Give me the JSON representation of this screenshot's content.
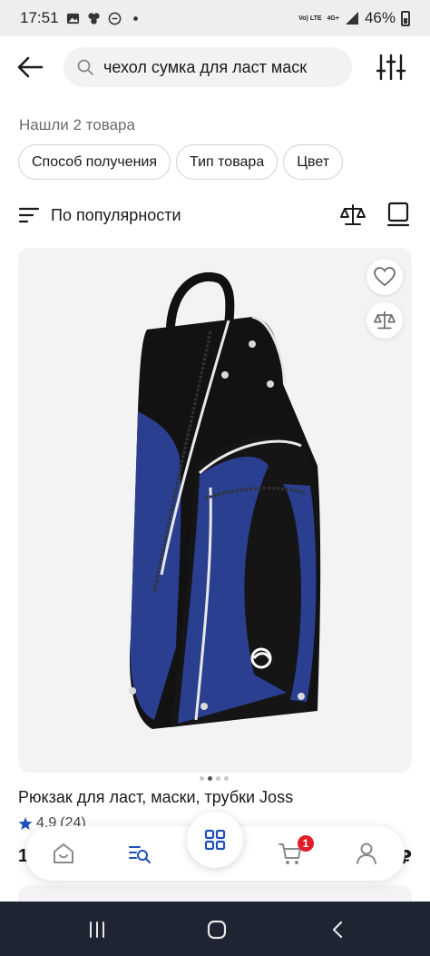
{
  "status_bar": {
    "time": "17:51",
    "signal_text": "4G+",
    "lte_text": "Vo) LTE",
    "battery": "46%"
  },
  "search": {
    "query": "чехол сумка для ласт маск"
  },
  "results": {
    "found_text": "Нашли 2 товара"
  },
  "filters": [
    {
      "label": "Способ получения"
    },
    {
      "label": "Тип товара"
    },
    {
      "label": "Цвет"
    }
  ],
  "sort": {
    "label": "По популярности"
  },
  "product": {
    "title": "Рюкзак для ласт, маски, трубки Joss",
    "rating": "4,9",
    "reviews": "(24)",
    "price_peek_left": "1",
    "price_peek_right": "₽",
    "image_count": 4,
    "active_image": 2,
    "brand_mark": "JOSS"
  },
  "bottom_nav": {
    "items": [
      {
        "icon": "home-icon"
      },
      {
        "icon": "catalog-search-icon"
      },
      {
        "icon": "grid-icon"
      },
      {
        "icon": "cart-icon"
      },
      {
        "icon": "profile-icon"
      }
    ],
    "cart_badge": "1"
  },
  "colors": {
    "accent_blue": "#1f4fb8",
    "badge_red": "#e11d2a",
    "bag_blue": "#2a3f8f",
    "android_nav": "#1f2433"
  }
}
